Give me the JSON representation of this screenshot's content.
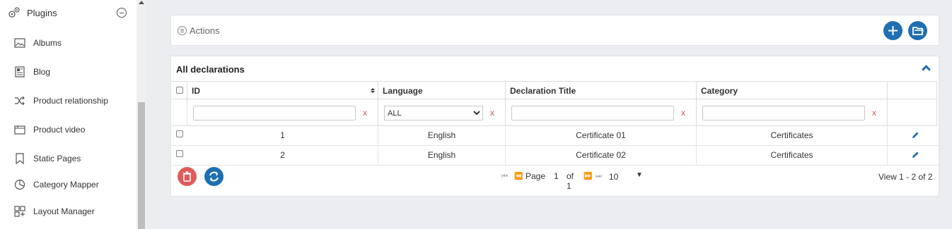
{
  "sidebar": {
    "header": {
      "label": "Plugins",
      "icon": "plugins-gears-icon"
    },
    "items": [
      {
        "label": "Albums",
        "icon": "image-icon"
      },
      {
        "label": "Blog",
        "icon": "blog-icon"
      },
      {
        "label": "Product relationship",
        "icon": "shuffle-icon"
      },
      {
        "label": "Product video",
        "icon": "video-icon"
      },
      {
        "label": "Static Pages",
        "icon": "bookmark-icon"
      },
      {
        "label": "Category Mapper",
        "icon": "pie-chart-icon"
      },
      {
        "label": "Layout Manager",
        "icon": "layout-icon"
      }
    ]
  },
  "actions": {
    "label": "Actions"
  },
  "grid": {
    "title": "All declarations",
    "columns": [
      "ID",
      "Language",
      "Declaration Title",
      "Category"
    ],
    "filter": {
      "language_selected": "ALL",
      "clear_label": "x"
    },
    "rows": [
      {
        "id": "1",
        "language": "English",
        "title": "Certificate 01",
        "category": "Certificates"
      },
      {
        "id": "2",
        "language": "English",
        "title": "Certificate 02",
        "category": "Certificates"
      }
    ],
    "pager": {
      "page_label": "Page",
      "page": "1",
      "of_label": "of 1",
      "page_size": "10"
    },
    "view_text": "View 1 - 2 of 2"
  },
  "colors": {
    "accent": "#1f6fb2",
    "danger": "#e05c5c",
    "background": "#ebedf0"
  }
}
